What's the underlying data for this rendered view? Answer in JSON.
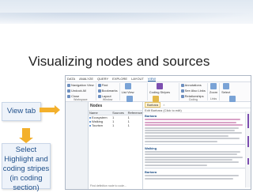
{
  "slide": {
    "title": "Visualizing nodes and sources",
    "callout_view": "View tab",
    "callout_select": "Select Highlight and coding stripes (in coding section)"
  },
  "colors": {
    "accent_arrow": "#f3b02c",
    "callout_text": "#1f4f8a",
    "callout_bg": "#eef3fa",
    "coding_stripe": "#7d4fb0",
    "highlight": "#d9a3c7"
  },
  "app": {
    "ribbon_tabs": [
      "DATA",
      "ANALYZE",
      "QUERY",
      "EXPLORE",
      "LAYOUT",
      "VIEW"
    ],
    "active_tab": "VIEW",
    "ribbon_groups": [
      {
        "label": "Workspace",
        "items": [
          "Navigation View",
          "Undock All",
          "Close"
        ]
      },
      {
        "label": "Window",
        "items": [
          "Find",
          "Bookmarks",
          "Layout"
        ]
      },
      {
        "label": "List View",
        "items": [
          "List View",
          "Detail View"
        ]
      },
      {
        "label": "Detail View",
        "items": [
          "Coding Stripes",
          "Highlight"
        ]
      },
      {
        "label": "Coding",
        "items": [
          "Annotations",
          "See Also Links",
          "Relationships"
        ]
      },
      {
        "label": "Links",
        "items": [
          "Zoom"
        ]
      },
      {
        "label": "Reference",
        "items": [
          "Select",
          "Reference View"
        ]
      }
    ],
    "ribbon_items_right": {
      "coding_stripes": "Coding Stripes",
      "highlight": "Highlight"
    },
    "nodes_pane": {
      "title": "Nodes",
      "columns": [
        "Name",
        "Sources",
        "References"
      ],
      "rows": [
        {
          "name": "Ecosystem",
          "sources": "1",
          "references": "1"
        },
        {
          "name": "Walking",
          "sources": "1",
          "references": "1"
        },
        {
          "name": "Tourism",
          "sources": "1",
          "references": "1"
        }
      ],
      "status": "Find definition node to code..."
    },
    "detail": {
      "doc_tab": "Barbara",
      "sub_text": "Edit Barbara (Click to edit)",
      "sections": [
        {
          "title": "Barbara"
        },
        {
          "title": "Walking"
        },
        {
          "title": "Barbara"
        }
      ]
    }
  }
}
